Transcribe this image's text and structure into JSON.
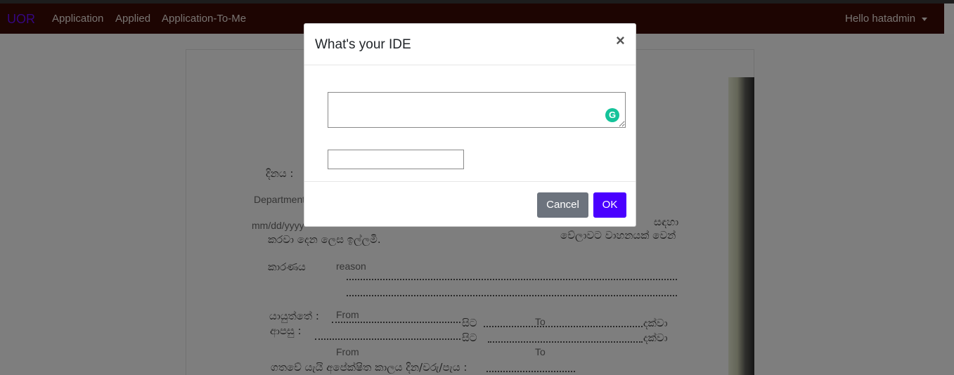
{
  "navbar": {
    "brand": "UOR",
    "links": [
      "Application",
      "Applied",
      "Application-To-Me"
    ],
    "user_greeting": "Hello hatadmin"
  },
  "document": {
    "date_label": "දිනය :",
    "department_placeholder": "Department",
    "date_placeholder": "mm/dd/yyyy",
    "request_text": "කරවා දෙන ලෙස ඉල්ලමි.",
    "request_text_right": "වේලාවට වාහනයක් වෙන්",
    "for_text": "සඳහා",
    "reason_label": "කාරණය",
    "reason_placeholder": "reason",
    "route_label_1": "යායුත්තේ :",
    "route_label_2": "ආපසු :",
    "from_placeholder": "From",
    "to_placeholder": "To",
    "from_suffix": "සිට",
    "to_suffix": "දක්වා",
    "time_label": "ගතවේ යැයි අපේක්ෂිත කාලය දින/වරු/පැය :"
  },
  "modal": {
    "title": "What's your IDE",
    "close_symbol": "×",
    "textarea_value": "",
    "input_value": "",
    "grammarly_symbol": "G",
    "cancel_label": "Cancel",
    "ok_label": "OK"
  },
  "colors": {
    "navbar_bg": "#3a0a04",
    "brand": "#6a0dff",
    "ok_button": "#4a00ff",
    "cancel_button": "#6c737d",
    "grammarly": "#15c39a"
  }
}
